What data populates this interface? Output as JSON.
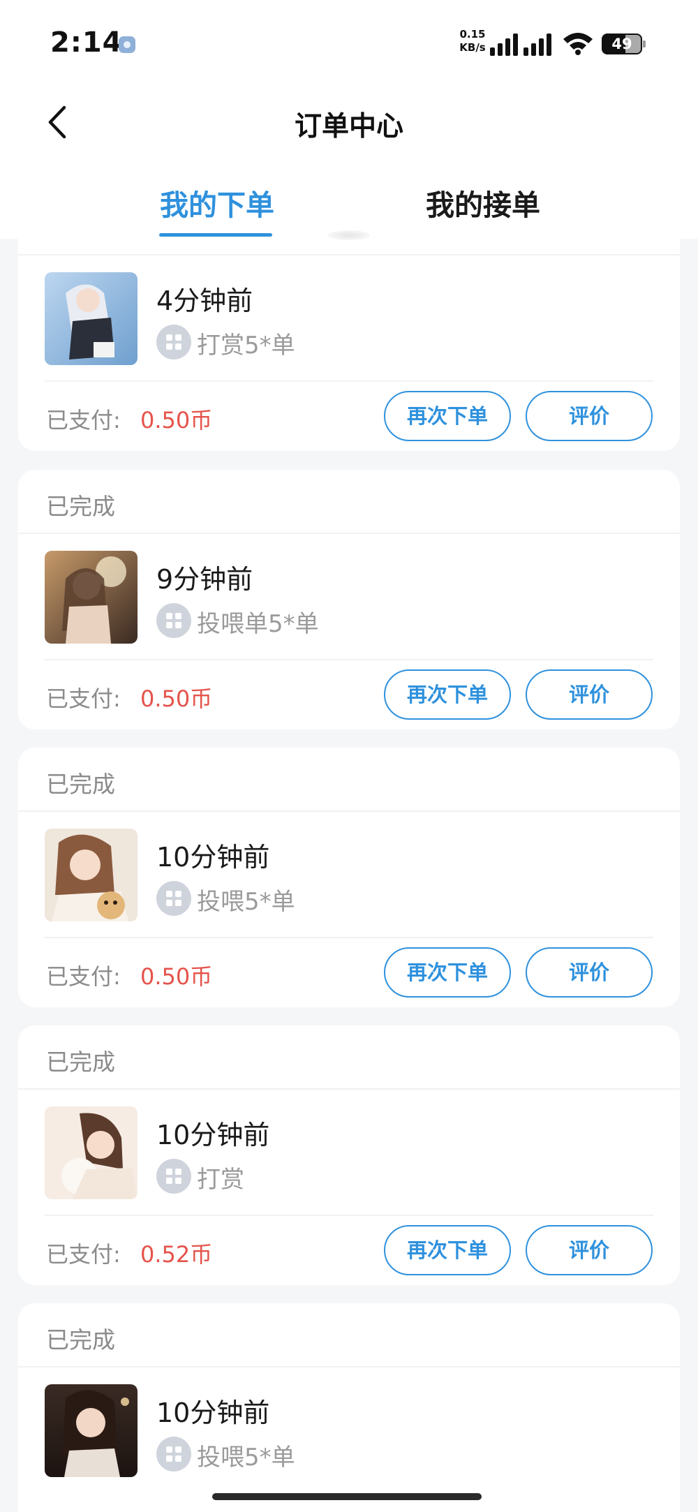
{
  "status_bar": {
    "time": "2:14",
    "net_speed_value": "0.15",
    "net_speed_unit": "KB/s",
    "battery": "49"
  },
  "header": {
    "title": "订单中心"
  },
  "tabs": [
    {
      "label": "我的下单"
    },
    {
      "label": "我的接单"
    }
  ],
  "labels": {
    "paid": "已支付:",
    "reorder": "再次下单",
    "review": "评价"
  },
  "orders": [
    {
      "status": "",
      "time_ago": "4分钟前",
      "service": "打赏5*单",
      "amount": "0.50币"
    },
    {
      "status": "已完成",
      "time_ago": "9分钟前",
      "service": "投喂单5*单",
      "amount": "0.50币"
    },
    {
      "status": "已完成",
      "time_ago": "10分钟前",
      "service": "投喂5*单",
      "amount": "0.50币"
    },
    {
      "status": "已完成",
      "time_ago": "10分钟前",
      "service": "打赏",
      "amount": "0.52币"
    },
    {
      "status": "已完成",
      "time_ago": "10分钟前",
      "service": "投喂5*单",
      "amount": ""
    }
  ],
  "colors": {
    "accent": "#2f91dd",
    "price": "#e5534b",
    "background": "#f5f6f8"
  }
}
